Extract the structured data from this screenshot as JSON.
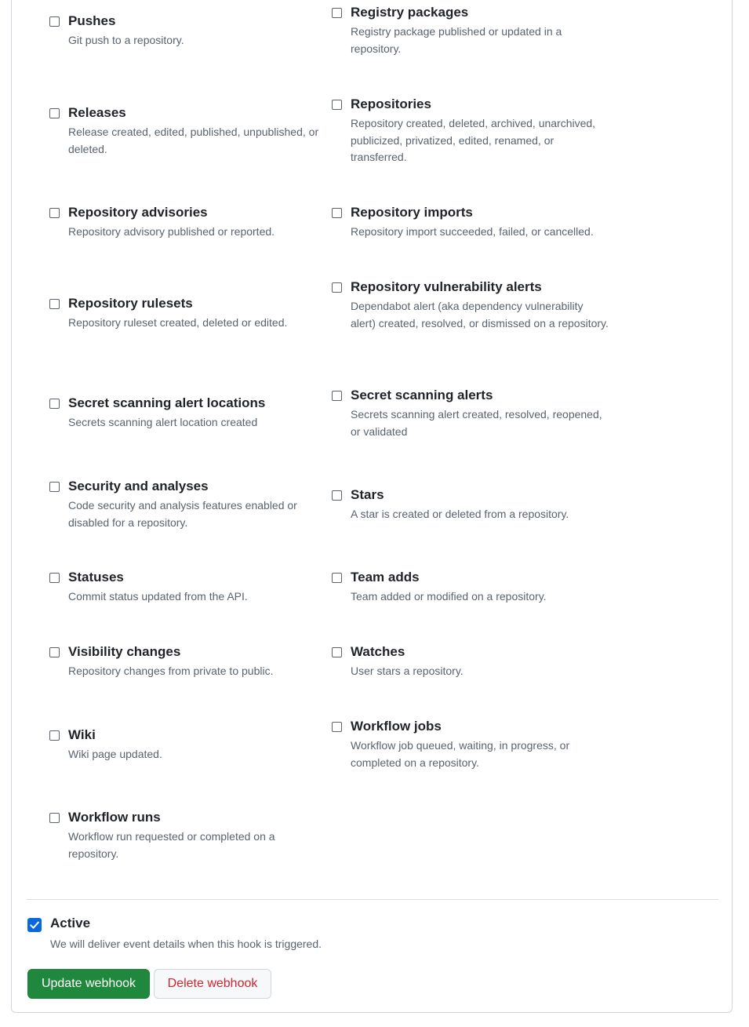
{
  "events": {
    "left": [
      {
        "title": "Pushes",
        "description": "Git push to a repository."
      },
      {
        "title": "Releases",
        "description": "Release created, edited, published, unpublished, or deleted."
      },
      {
        "title": "Repository advisories",
        "description": "Repository advisory published or reported."
      },
      {
        "title": "Repository rulesets",
        "description": "Repository ruleset created, deleted or edited."
      },
      {
        "title": "Secret scanning alert locations",
        "description": "Secrets scanning alert location created"
      },
      {
        "title": "Security and analyses",
        "description": "Code security and analysis features enabled or disabled for a repository."
      },
      {
        "title": "Statuses",
        "description": "Commit status updated from the API."
      },
      {
        "title": "Visibility changes",
        "description": "Repository changes from private to public."
      },
      {
        "title": "Wiki",
        "description": "Wiki page updated."
      },
      {
        "title": "Workflow runs",
        "description": "Workflow run requested or completed on a repository."
      }
    ],
    "right": [
      {
        "title": "Registry packages",
        "description": "Registry package published or updated in a repository."
      },
      {
        "title": "Repositories",
        "description": "Repository created, deleted, archived, unarchived, publicized, privatized, edited, renamed, or transferred."
      },
      {
        "title": "Repository imports",
        "description": "Repository import succeeded, failed, or cancelled."
      },
      {
        "title": "Repository vulnerability alerts",
        "description": "Dependabot alert (aka dependency vulnerability alert) created, resolved, or dismissed on a repository."
      },
      {
        "title": "Secret scanning alerts",
        "description": "Secrets scanning alert created, resolved, reopened, or validated"
      },
      {
        "title": "Stars",
        "description": "A star is created or deleted from a repository."
      },
      {
        "title": "Team adds",
        "description": "Team added or modified on a repository."
      },
      {
        "title": "Watches",
        "description": "User stars a repository."
      },
      {
        "title": "Workflow jobs",
        "description": "Workflow job queued, waiting, in progress, or completed on a repository."
      }
    ]
  },
  "active": {
    "label": "Active",
    "description": "We will deliver event details when this hook is triggered.",
    "checked": true
  },
  "actions": {
    "update_label": "Update webhook",
    "delete_label": "Delete webhook"
  },
  "colors": {
    "accent_blue": "#0969da",
    "primary_green": "#1f883d",
    "danger_red": "#d1242f"
  }
}
